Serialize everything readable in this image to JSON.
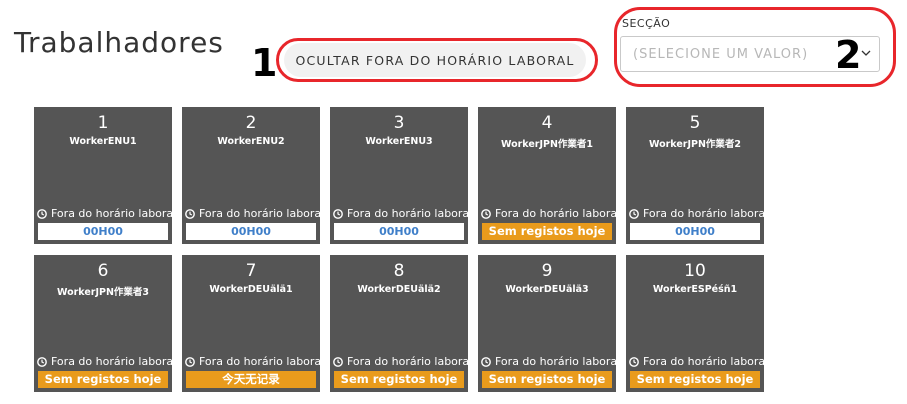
{
  "page": {
    "title": "Trabalhadores"
  },
  "annotations": {
    "marker_1": "1",
    "marker_2": "2",
    "outline_color": "#e8262b"
  },
  "toolbar": {
    "hide_off_hours_label": "OCULTAR FORA DO HORÁRIO LABORAL"
  },
  "section_filter": {
    "label": "SECÇÃO",
    "placeholder": "(SELECIONE UM VALOR)",
    "icon": "chevron-down-icon"
  },
  "colors": {
    "card_background": "#555555",
    "no_records_badge": "#e99b1c",
    "time_text": "#3f7fc9"
  },
  "workers": [
    {
      "number": "1",
      "name": "WorkerENU1",
      "status": "Fora do horário laboral",
      "badge": "00H00",
      "badge_type": "time"
    },
    {
      "number": "2",
      "name": "WorkerENU2",
      "status": "Fora do horário laboral",
      "badge": "00H00",
      "badge_type": "time"
    },
    {
      "number": "3",
      "name": "WorkerENU3",
      "status": "Fora do horário laboral",
      "badge": "00H00",
      "badge_type": "time"
    },
    {
      "number": "4",
      "name": "WorkerJPN作業者1",
      "status": "Fora do horário laboral",
      "badge": "Sem registos hoje",
      "badge_type": "none"
    },
    {
      "number": "5",
      "name": "WorkerJPN作業者2",
      "status": "Fora do horário laboral",
      "badge": "00H00",
      "badge_type": "time"
    },
    {
      "number": "6",
      "name": "WorkerJPN作業者3",
      "status": "Fora do horário laboral",
      "badge": "Sem registos hoje",
      "badge_type": "none"
    },
    {
      "number": "7",
      "name": "WorkerDEUälä1",
      "status": "Fora do horário laboral",
      "badge": "今天无记录",
      "badge_type": "none"
    },
    {
      "number": "8",
      "name": "WorkerDEUälä2",
      "status": "Fora do horário laboral",
      "badge": "Sem registos hoje",
      "badge_type": "none"
    },
    {
      "number": "9",
      "name": "WorkerDEUälä3",
      "status": "Fora do horário laboral",
      "badge": "Sem registos hoje",
      "badge_type": "none"
    },
    {
      "number": "10",
      "name": "WorkerESPéśñ1",
      "status": "Fora do horário laboral",
      "badge": "Sem registos hoje",
      "badge_type": "none"
    }
  ]
}
